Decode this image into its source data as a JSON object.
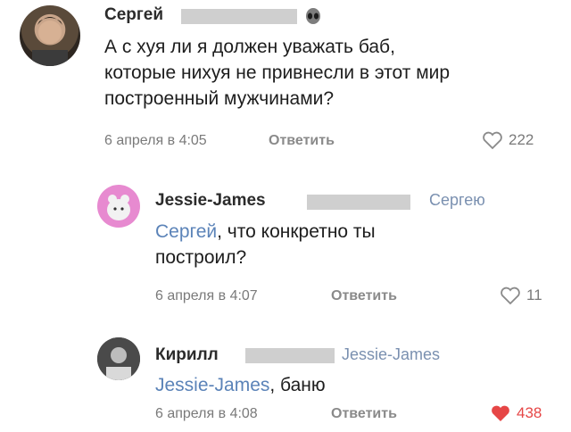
{
  "comments": [
    {
      "author": "Сергей",
      "text_lines": [
        "А с хуя ли я должен уважать баб,",
        "которые нихуя не привнесли в этот мир",
        "построенный мужчинами?"
      ],
      "date": "6 апреля в 4:05",
      "reply_label": "Ответить",
      "likes": "222"
    },
    {
      "author": "Jessie-James",
      "reply_to": "Сергею",
      "mention": "Сергей",
      "text_line1_rest": ", что конкретно ты",
      "text_line2": "построил?",
      "date": "6 апреля в 4:07",
      "reply_label": "Ответить",
      "likes": "11"
    },
    {
      "author": "Кирилл",
      "reply_to": "Jessie-James",
      "mention": "Jessie-James",
      "text_rest": ", баню",
      "date": "6 апреля в 4:08",
      "reply_label": "Ответить",
      "likes": "438",
      "liked_color": "#e64646"
    }
  ]
}
